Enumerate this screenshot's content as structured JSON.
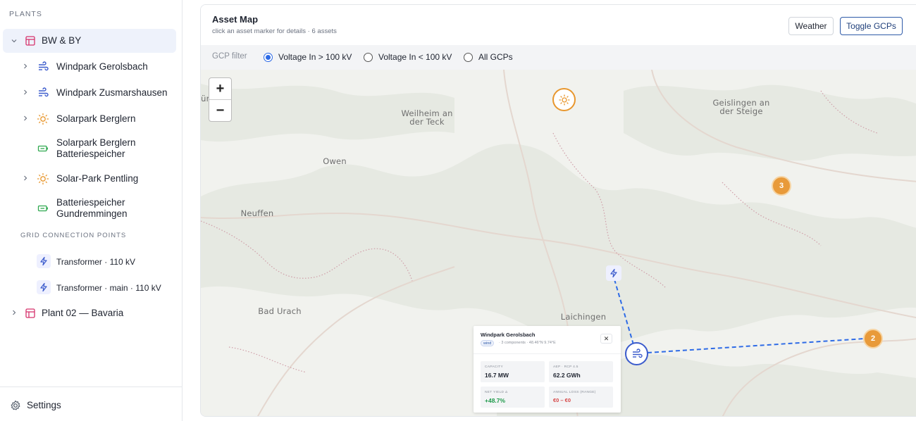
{
  "sidebar": {
    "plants_title": "PLANTS",
    "gcp_title": "GRID CONNECTION POINTS",
    "root": {
      "label": "BW & BY"
    },
    "plants": [
      {
        "label": "Windpark Gerolsbach",
        "type": "wind"
      },
      {
        "label": "Windpark Zusmarshausen",
        "type": "wind"
      },
      {
        "label": "Solarpark Berglern",
        "type": "solar"
      },
      {
        "label_line1": "Solarpark Berglern",
        "label_line2": "Batteriespeicher",
        "type": "battery"
      },
      {
        "label": "Solar-Park Pentling",
        "type": "solar"
      },
      {
        "label_line1": "Batteriespeicher",
        "label_line2": "Gundremmingen",
        "type": "battery"
      }
    ],
    "gcps": [
      {
        "label": "Transformer · 110 kV"
      },
      {
        "label": "Transformer · main · 110 kV"
      }
    ],
    "plant2": {
      "label": "Plant 02 — Bavaria"
    },
    "settings_label": "Settings"
  },
  "header": {
    "title": "Asset Map",
    "subtitle": "click an asset marker for details · 6 assets",
    "weather_button": "Weather",
    "toggle_gcp_button": "Toggle GCPs"
  },
  "filter": {
    "label": "GCP filter",
    "options": [
      "Voltage In > 100 kV",
      "Voltage In < 100 kV",
      "All GCPs"
    ],
    "selected": "Voltage In > 100 kV"
  },
  "map": {
    "zoom_in": "+",
    "zoom_out": "−",
    "places": {
      "weilheim": [
        "Weilheim an",
        "der Teck"
      ],
      "geislingen": [
        "Geislingen an",
        "der Steige"
      ],
      "owen": "Owen",
      "neuffen": "Neuffen",
      "bad_urach": "Bad Urach",
      "laichingen": "Laichingen",
      "cut_left": "ürn"
    },
    "clusters": {
      "a": "3",
      "b": "2"
    },
    "route_color": "#2e6be6"
  },
  "popup": {
    "title": "Windpark Gerolsbach",
    "tag": "wind",
    "meta": "· 3 components · 48.46°N 9.74°E",
    "close": "✕",
    "stats": [
      {
        "label": "CAPACITY",
        "value": "16.7 MW",
        "color": "#1f2430"
      },
      {
        "label": "AEP · RCP 4.5",
        "value": "62.2 GWh",
        "color": "#1f2430"
      },
      {
        "label": "NET YIELD Δ",
        "value": "+48.7%",
        "color": "#1e9a4a"
      },
      {
        "label": "ANNUAL LOSS (RANGE)",
        "value": "€0 – €0",
        "color": "#d64545"
      }
    ]
  },
  "colors": {
    "accent": "#2e5aa8",
    "wind": "#3b5bcc",
    "solar": "#e8972e",
    "battery": "#2fa84f",
    "cluster": "#e89a3a"
  }
}
